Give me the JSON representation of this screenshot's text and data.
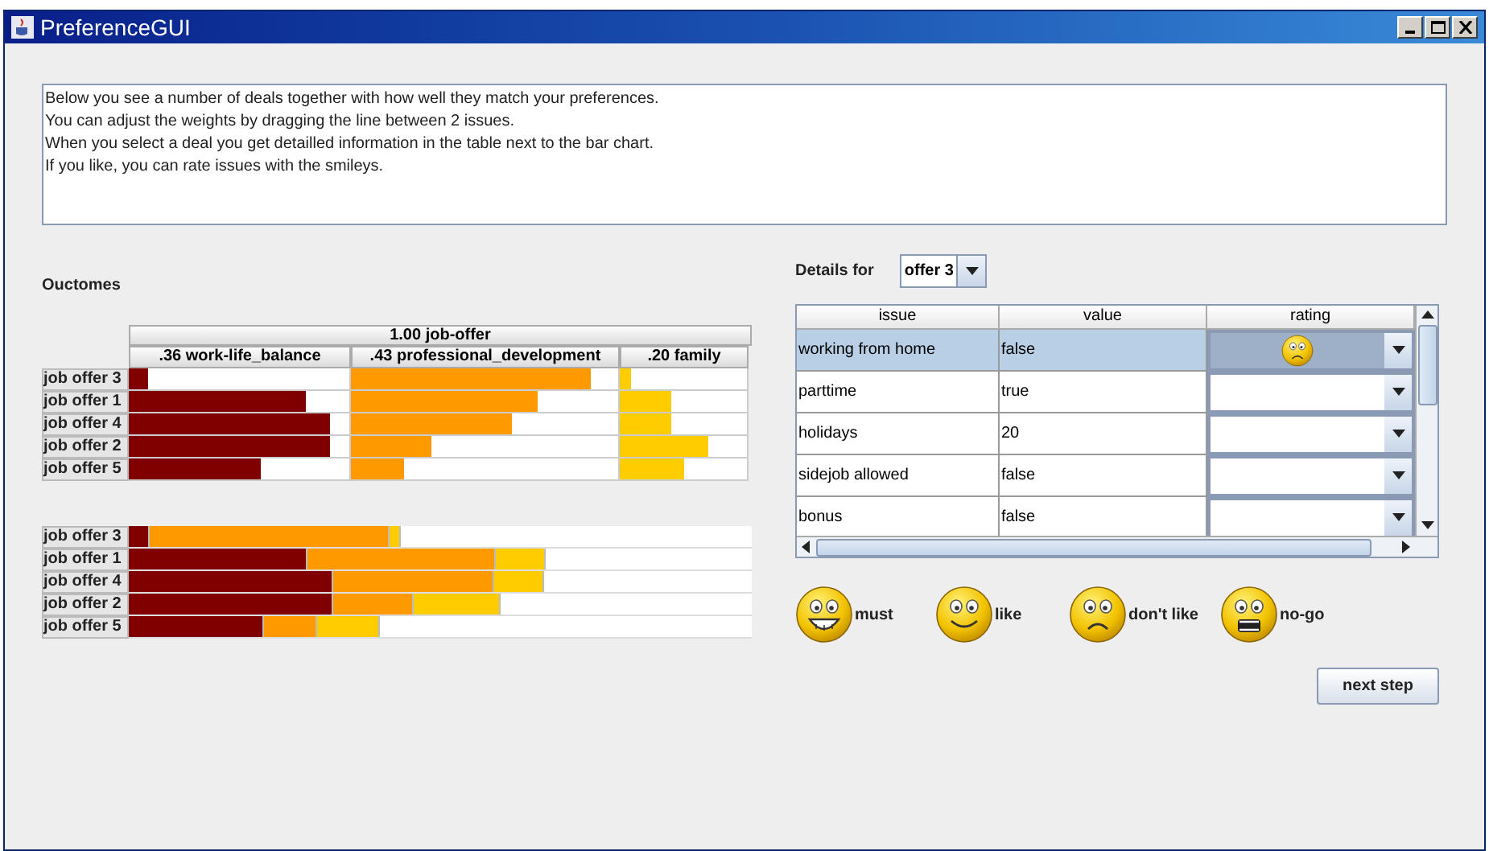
{
  "window": {
    "title": "PreferenceGUI"
  },
  "instructions": [
    "Below you see a number of deals together with how well they match your preferences.",
    "You can adjust the weights by dragging the line between 2 issues.",
    "When you select a deal you get detailled information in the table next to the bar chart.",
    "If you like, you can rate issues with the smileys."
  ],
  "outcomes": {
    "title": "Ouctomes",
    "root": "1.00  job-offer",
    "columns": [
      {
        "label": ".36  work-life_balance",
        "color": "#800000"
      },
      {
        "label": ".43  professional_development",
        "color": "#ff9900"
      },
      {
        "label": ".20  family",
        "color": "#ffcc00"
      }
    ],
    "rows": [
      {
        "label": "job offer 3",
        "cells": [
          {
            "level": 0.09
          },
          {
            "level": 0.9
          },
          {
            "level": 0.09
          }
        ]
      },
      {
        "label": "job offer 1",
        "cells": [
          {
            "level": 0.8
          },
          {
            "level": 0.7
          },
          {
            "level": 0.4
          }
        ]
      },
      {
        "label": "job offer 4",
        "cells": [
          {
            "level": 0.91
          },
          {
            "level": 0.6
          },
          {
            "level": 0.4
          }
        ]
      },
      {
        "label": "job offer 2",
        "cells": [
          {
            "level": 0.91
          },
          {
            "level": 0.3
          },
          {
            "level": 0.7
          }
        ]
      },
      {
        "label": "job offer 5",
        "cells": [
          {
            "level": 0.6
          },
          {
            "level": 0.2
          },
          {
            "level": 0.5
          }
        ]
      }
    ],
    "total_rows": [
      {
        "label": "job offer 3"
      },
      {
        "label": "job offer 1"
      },
      {
        "label": "job offer 4"
      },
      {
        "label": "job offer 2"
      },
      {
        "label": "job offer 5"
      }
    ]
  },
  "details": {
    "label": "Details for",
    "selector": "offer 3",
    "columns": [
      "issue",
      "value",
      "rating"
    ],
    "rows": [
      {
        "issue": "working from home",
        "value": "false",
        "kind": "dont_like",
        "selected": true
      },
      {
        "issue": "parttime",
        "value": "true",
        "kind": "none",
        "selected": false
      },
      {
        "issue": "holidays",
        "value": "20",
        "kind": "none",
        "selected": false
      },
      {
        "issue": "sidejob allowed",
        "value": "false",
        "kind": "none",
        "selected": false
      },
      {
        "issue": "bonus",
        "value": "false",
        "kind": "none",
        "selected": false
      }
    ]
  },
  "legend": [
    {
      "kind": "must",
      "label": "must"
    },
    {
      "kind": "like",
      "label": "like"
    },
    {
      "kind": "dont_like",
      "label": "don't like"
    },
    {
      "kind": "nogo",
      "label": "no-go"
    }
  ],
  "button": "next step"
}
